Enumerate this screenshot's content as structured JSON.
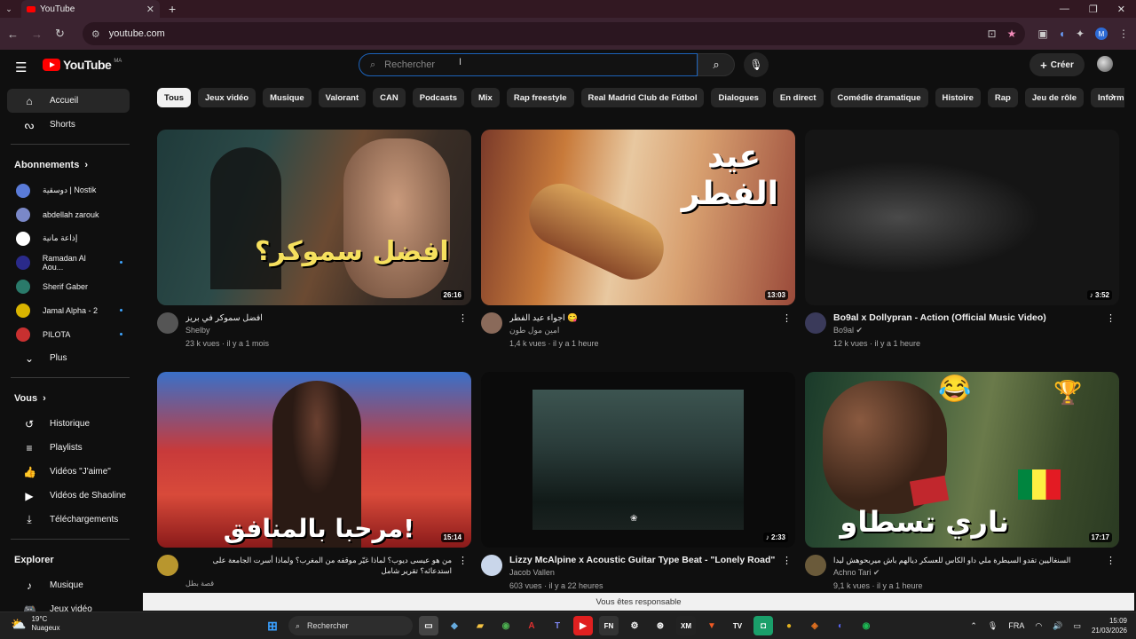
{
  "browser": {
    "tab_title": "YouTube",
    "url": "youtube.com",
    "profile_initial": "M"
  },
  "youtube": {
    "logo_text": "YouTube",
    "country_code": "MA",
    "search_placeholder": "Rechercher",
    "create_label": "Créer"
  },
  "sidebar": {
    "main": [
      {
        "label": "Accueil",
        "icon": "home-icon"
      },
      {
        "label": "Shorts",
        "icon": "shorts-icon"
      }
    ],
    "subscriptions_title": "Abonnements",
    "subscriptions": [
      {
        "name": "دوسقية | Nostik",
        "color": "#5a7bd8",
        "dot": false
      },
      {
        "name": "abdellah zarouk",
        "color": "#7a88c8",
        "dot": false
      },
      {
        "name": "إذاعة مانية",
        "color": "#ffffff",
        "dot": false
      },
      {
        "name": "Ramadan Al Aou...",
        "color": "#2a2a8a",
        "dot": true
      },
      {
        "name": "Sherif Gaber",
        "color": "#2a7a6a",
        "dot": false
      },
      {
        "name": "Jamal Alpha - 2",
        "color": "#d9b400",
        "dot": true
      },
      {
        "name": "PILOTA",
        "color": "#c83030",
        "dot": true
      }
    ],
    "more_label": "Plus",
    "you_title": "Vous",
    "you_items": [
      {
        "label": "Historique",
        "icon": "history-icon"
      },
      {
        "label": "Playlists",
        "icon": "playlists-icon"
      },
      {
        "label": "Vidéos \"J'aime\"",
        "icon": "thumbs-up-icon"
      },
      {
        "label": "Vidéos de Shaoline",
        "icon": "your-videos-icon"
      },
      {
        "label": "Téléchargements",
        "icon": "download-icon"
      }
    ],
    "explore_title": "Explorer",
    "explore_items": [
      {
        "label": "Musique",
        "icon": "music-icon"
      },
      {
        "label": "Jeux vidéo",
        "icon": "gaming-icon"
      }
    ]
  },
  "chips": [
    "Tous",
    "Jeux vidéo",
    "Musique",
    "Valorant",
    "CAN",
    "Podcasts",
    "Mix",
    "Rap freestyle",
    "Real Madrid Club de Fútbol",
    "Dialogues",
    "En direct",
    "Comédie dramatique",
    "Histoire",
    "Rap",
    "Jeu de rôle",
    "Informations"
  ],
  "videos": [
    {
      "title": "افضل سموكر في بريز",
      "channel": "Shelby",
      "stats": "23 k vues · il y a 1 mois",
      "duration": "26:16",
      "rtl": true,
      "thumb_text": "افضل سموكر؟",
      "avatar_color": "#555"
    },
    {
      "title": "اجواء عيد الفطر 😋",
      "channel": "امين مول طون",
      "stats": "1,4 k vues · il y a 1 heure",
      "duration": "13:03",
      "rtl": true,
      "thumb_text": "عيد الفطر",
      "avatar_color": "#8a6a5a"
    },
    {
      "title": "Bo9al x Dollypran - Action (Official Music Video)",
      "channel": "Bo9al ✔",
      "stats": "12 k vues · il y a 1 heure",
      "duration": "♪ 3:52",
      "rtl": false,
      "thumb_text": "",
      "avatar_color": "#3a3a5a"
    },
    {
      "title": "من هو عيسى ديوب؟ لماذا غيّر موقفه من المغرب؟ ولماذا أسرت الجامعة على استدعائه؟ تقرير شامل",
      "channel": "قصة بطل",
      "stats": "",
      "duration": "15:14",
      "rtl": true,
      "thumb_text": "!مرحبا بالمنافق",
      "avatar_color": "#b8962e"
    },
    {
      "title": "Lizzy McAlpine x Acoustic Guitar Type Beat - \"Lonely Road\"",
      "channel": "Jacob Vallen",
      "stats": "603 vues · il y a 22 heures",
      "duration": "♪ 2:33",
      "rtl": false,
      "thumb_text": "",
      "avatar_color": "#c9d6ea"
    },
    {
      "title": "السنغاليين تقدو السيطرة ملي داو الكاس للعسكر ديالهم باش ميربحوهش ليدا",
      "channel": "Achno Tari ✔",
      "stats": "9,1 k vues · il y a 1 heure",
      "duration": "17:17",
      "rtl": true,
      "thumb_text": "ناري تسطاو",
      "avatar_color": "#6a5a3a"
    }
  ],
  "toast": "Vous êtes responsable",
  "taskbar": {
    "temperature": "19°C",
    "weather": "Nuageux",
    "search_label": "Rechercher",
    "language": "FRA",
    "time": "15:09",
    "date": "21/03/2026"
  }
}
